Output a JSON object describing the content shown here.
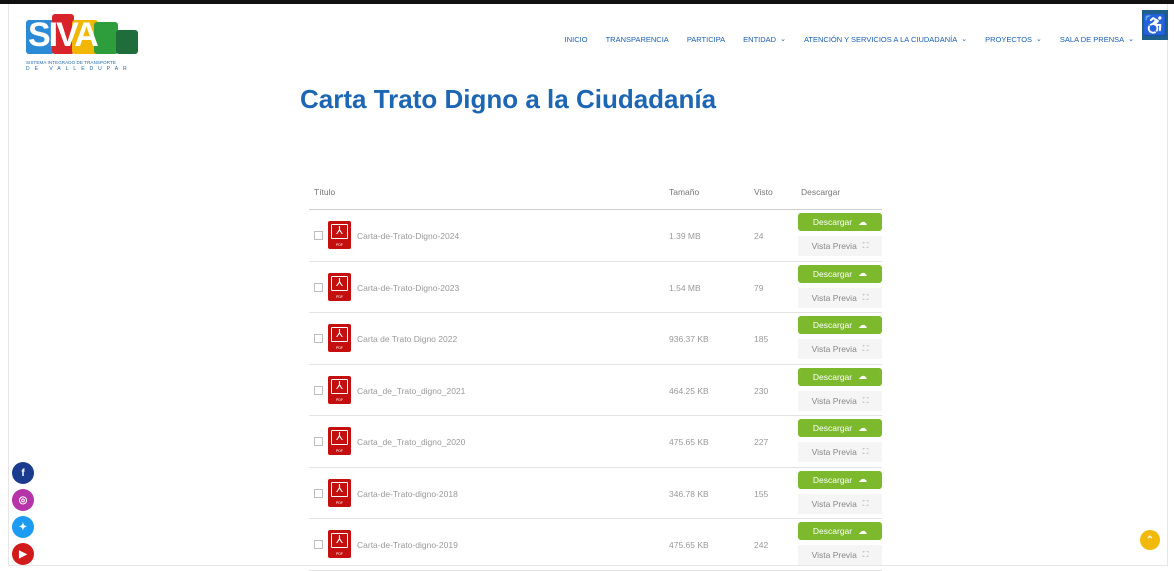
{
  "logo": {
    "name": "SIVA",
    "line1": "SISTEMA INTEGRADO DE TRANSPORTE",
    "line2": "DE VALLEDUPAR"
  },
  "nav": {
    "items": [
      {
        "label": "INICIO",
        "dropdown": false
      },
      {
        "label": "TRANSPARENCIA",
        "dropdown": false
      },
      {
        "label": "PARTICIPA",
        "dropdown": false
      },
      {
        "label": "ENTIDAD",
        "dropdown": true
      },
      {
        "label": "ATENCIÓN Y SERVICIOS A LA CIUDADANÍA",
        "dropdown": true
      },
      {
        "label": "PROYECTOS",
        "dropdown": true
      },
      {
        "label": "SALA DE PRENSA",
        "dropdown": true
      }
    ],
    "accessibility_icon": "wheelchair-icon"
  },
  "page": {
    "title": "Carta Trato Digno a la Ciudadanía"
  },
  "table": {
    "headers": {
      "title": "Título",
      "size": "Tamaño",
      "views": "Visto",
      "download": "Descargar"
    },
    "download_label": "Descargar",
    "preview_label": "Vista Previa",
    "rows": [
      {
        "name": "Carta-de-Trato-Digno-2024",
        "size": "1.39 MB",
        "views": "24"
      },
      {
        "name": "Carta-de-Trato-Digno-2023",
        "size": "1.54 MB",
        "views": "79"
      },
      {
        "name": "Carta de Trato Digno 2022",
        "size": "936.37 KB",
        "views": "185"
      },
      {
        "name": "Carta_de_Trato_digno_2021",
        "size": "464.25 KB",
        "views": "230"
      },
      {
        "name": "Carta_de_Trato_digno_2020",
        "size": "475.65 KB",
        "views": "227"
      },
      {
        "name": "Carta-de-Trato-digno-2018",
        "size": "346.78 KB",
        "views": "155"
      },
      {
        "name": "Carta-de-Trato-digno-2019",
        "size": "475.65 KB",
        "views": "242"
      }
    ]
  },
  "social": [
    {
      "name": "facebook",
      "glyph": "f",
      "color": "#1b3b8f"
    },
    {
      "name": "instagram",
      "glyph": "◎",
      "color": "#b534a8"
    },
    {
      "name": "twitter",
      "glyph": "✦",
      "color": "#1d9bf0"
    },
    {
      "name": "youtube",
      "glyph": "▶",
      "color": "#d11a1a"
    }
  ],
  "colors": {
    "title": "#1d66b3",
    "nav": "#1a5fb4",
    "download_button": "#7cb92c",
    "pdf_icon": "#c40f0f",
    "back_to_top": "#f0b90b"
  }
}
